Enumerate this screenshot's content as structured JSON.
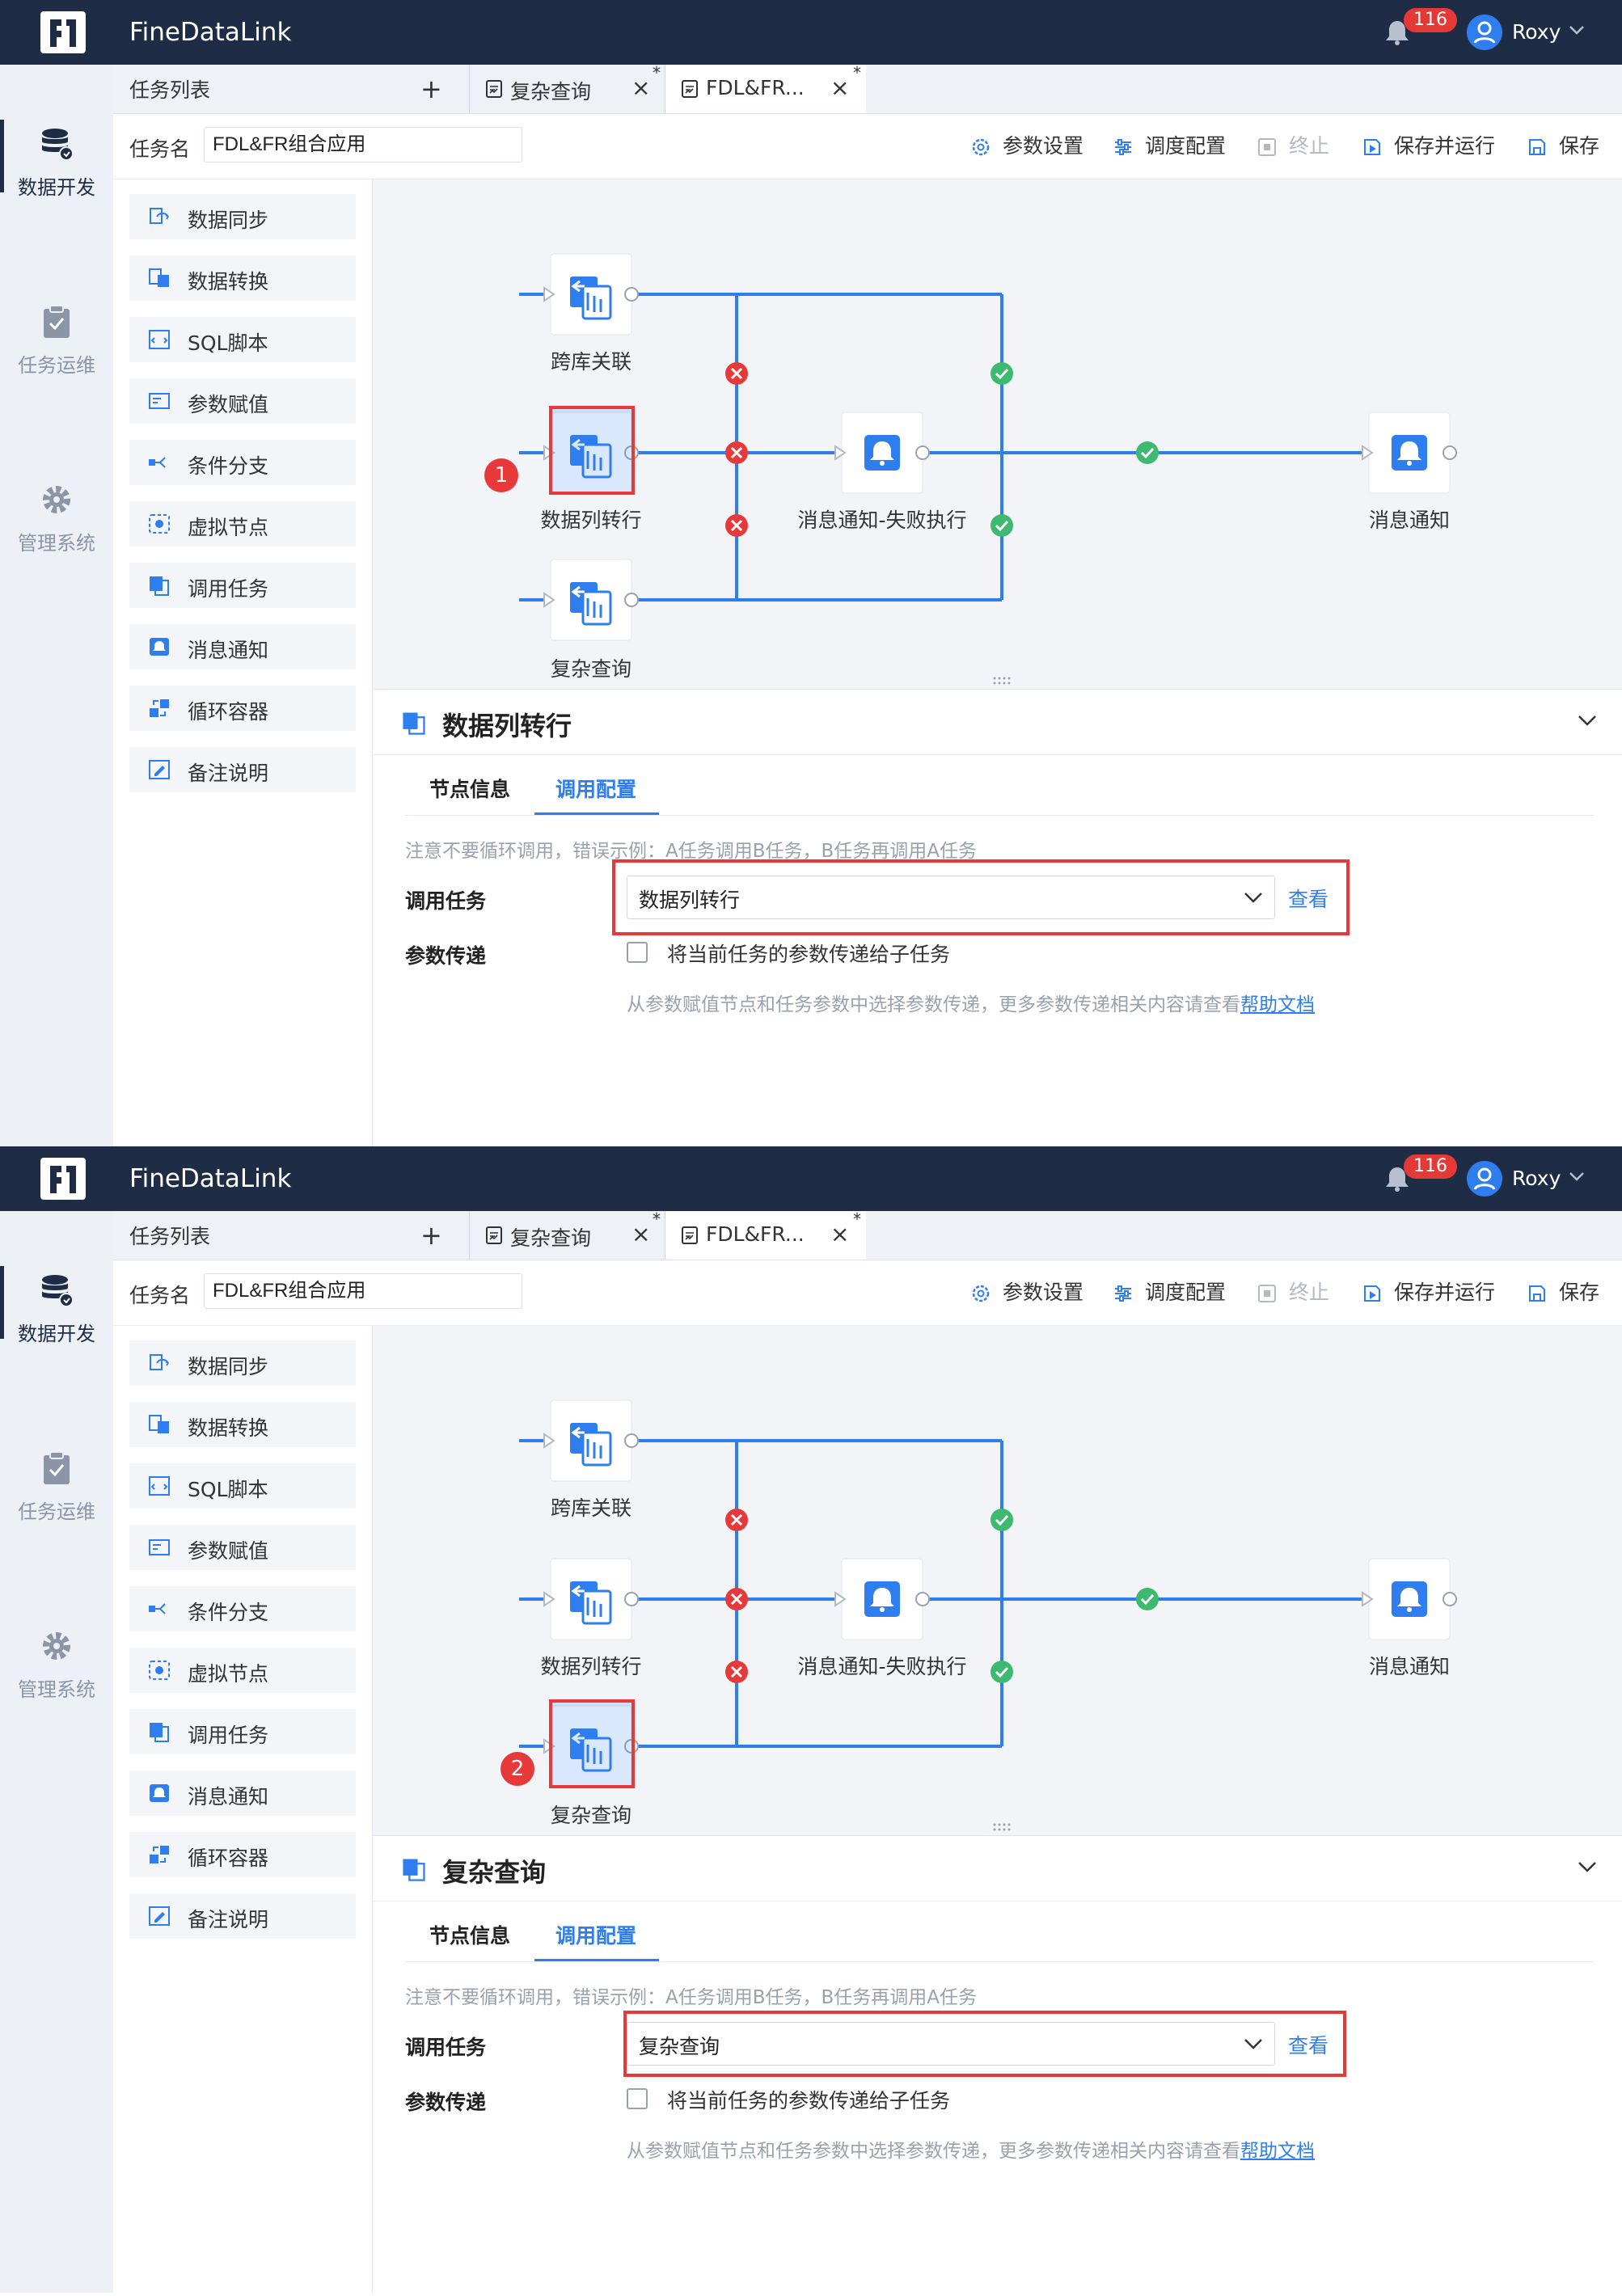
{
  "app": {
    "brand": "FineDataLink",
    "notification_count": "116",
    "user": "Roxy"
  },
  "nav": [
    {
      "label": "数据开发",
      "icon": "database-icon"
    },
    {
      "label": "任务运维",
      "icon": "clipboard-icon"
    },
    {
      "label": "管理系统",
      "icon": "gear-icon"
    }
  ],
  "tabs": {
    "list_label": "任务列表",
    "items": [
      {
        "title": "复杂查询",
        "modified": "*"
      },
      {
        "title": "FDL&FR...",
        "modified": "*"
      }
    ]
  },
  "toolbar": {
    "task_name_label": "任务名",
    "task_name_value": "FDL&FR组合应用",
    "buttons": [
      "参数设置",
      "调度配置",
      "终止",
      "保存并运行",
      "保存"
    ]
  },
  "palette": [
    "数据同步",
    "数据转换",
    "SQL脚本",
    "参数赋值",
    "条件分支",
    "虚拟节点",
    "调用任务",
    "消息通知",
    "循环容器",
    "备注说明"
  ],
  "canvas": {
    "nodes": [
      "跨库关联",
      "数据列转行",
      "复杂查询",
      "消息通知-失败执行",
      "消息通知"
    ]
  },
  "panel": {
    "tabs": [
      "节点信息",
      "调用配置"
    ],
    "note": "注意不要循环调用，错误示例：A任务调用B任务，B任务再调用A任务",
    "invoke_label": "调用任务",
    "view_link": "查看",
    "param_label": "参数传递",
    "checkbox_label": "将当前任务的参数传递给子任务",
    "hint": "从参数赋值节点和任务参数中选择参数传递，更多参数传递相关内容请查看",
    "help_link": "帮助文档"
  },
  "screens": [
    {
      "marker": "1",
      "title": "数据列转行",
      "invoke_value": "数据列转行"
    },
    {
      "marker": "2",
      "title": "复杂查询",
      "invoke_value": "复杂查询"
    }
  ],
  "colors": {
    "header": "#1f2c46",
    "accent": "#2f7ef0",
    "error": "#e8393a",
    "success": "#3dba6f"
  }
}
